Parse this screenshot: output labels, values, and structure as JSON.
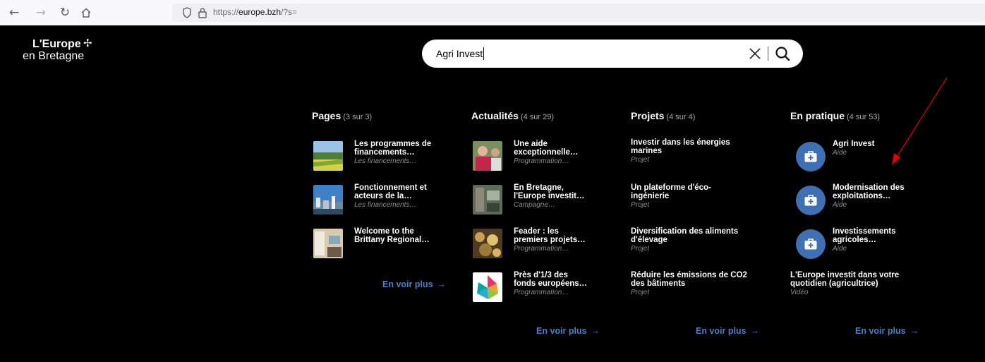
{
  "browser": {
    "url_prefix": "https://",
    "url_domain": "europe.bzh",
    "url_suffix": "/?s=",
    "icons": [
      "back-arrow-icon",
      "forward-arrow-icon",
      "reload-icon",
      "home-icon",
      "shield-icon",
      "lock-icon"
    ]
  },
  "logo": {
    "line1": "L'Europe",
    "line2": "en Bretagne"
  },
  "search": {
    "value": "Agri Invest"
  },
  "columns": [
    {
      "title": "Pages",
      "count": "(3 sur 3)",
      "items": [
        {
          "title_l1": "Les programmes de",
          "title_l2": "financements…",
          "category": "Les financements…",
          "thumb": "landscape"
        },
        {
          "title_l1": "Fonctionnement et",
          "title_l2": "acteurs de la…",
          "category": "Les financements…",
          "thumb": "city"
        },
        {
          "title_l1": "Welcome to the",
          "title_l2": "Brittany Regional…",
          "category": "",
          "thumb": "office"
        }
      ],
      "more": "En voir plus"
    },
    {
      "title": "Actualités",
      "count": "(4 sur 29)",
      "items": [
        {
          "title_l1": "Une aide",
          "title_l2": "exceptionnelle…",
          "category": "Programmation…",
          "thumb": "people"
        },
        {
          "title_l1": "En Bretagne,",
          "title_l2": "l'Europe investit…",
          "category": "Campagne…",
          "thumb": "indoor"
        },
        {
          "title_l1": "Feader : les",
          "title_l2": "premiers projets…",
          "category": "Programmation…",
          "thumb": "vine"
        },
        {
          "title_l1": "Près d'1/3 des",
          "title_l2": "fonds européens…",
          "category": "Programmation…",
          "thumb": "infographic"
        }
      ],
      "more": "En voir plus"
    },
    {
      "title": "Projets",
      "count": "(4 sur 4)",
      "items": [
        {
          "title_l1": "Investir dans les énergies",
          "title_l2": "marines",
          "category": "Projet"
        },
        {
          "title_l1": "Un plateforme d'éco-",
          "title_l2": "ingénierie",
          "category": "Projet"
        },
        {
          "title_l1": "Diversification des aliments",
          "title_l2": "d'élevage",
          "category": "Projet"
        },
        {
          "title_l1": "Réduire les émissions de CO2",
          "title_l2": "des bâtiments",
          "category": "Projet"
        }
      ],
      "more": "En voir plus"
    },
    {
      "title": "En pratique",
      "count": "(4 sur 53)",
      "items": [
        {
          "title_l1": "Agri Invest",
          "title_l2": "",
          "category": "Aide",
          "icon": "briefcase-plus-icon"
        },
        {
          "title_l1": "Modernisation des",
          "title_l2": "exploitations…",
          "category": "Aide",
          "icon": "briefcase-plus-icon"
        },
        {
          "title_l1": "Investissements",
          "title_l2": "agricoles…",
          "category": "Aide",
          "icon": "briefcase-plus-icon"
        },
        {
          "title_l1": "L'Europe investit dans votre",
          "title_l2": "quotidien (agricultrice)",
          "category": "Vidéo"
        }
      ],
      "more": "En voir plus"
    }
  ],
  "colors": {
    "accent": "#4d7fc4",
    "icon_bg": "#4070b4",
    "annotation": "#e00000"
  }
}
